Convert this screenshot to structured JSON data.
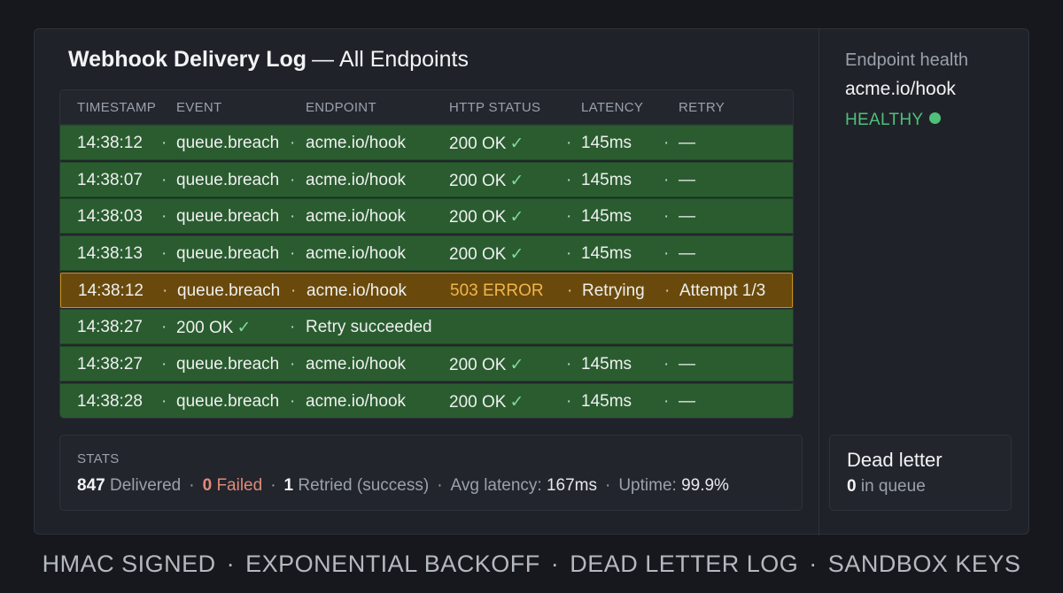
{
  "panel": {
    "title_strong": "Webhook Delivery Log",
    "title_dash": "—",
    "title_rest": "All Endpoints"
  },
  "table": {
    "columns": [
      "TIMESTAMP",
      "EVENT",
      "ENDPOINT",
      "HTTP STATUS",
      "LATENCY",
      "RETRY"
    ],
    "separator": "·",
    "check_glyph": "✓",
    "rows": [
      {
        "timestamp": "14:38:12",
        "event": "queue.breach",
        "endpoint": "acme.io/hook",
        "status": "200 OK",
        "latency": "145ms",
        "retry": "—"
      },
      {
        "timestamp": "14:38:07",
        "event": "queue.breach",
        "endpoint": "acme.io/hook",
        "status": "200 OK",
        "latency": "145ms",
        "retry": "—"
      },
      {
        "timestamp": "14:38:03",
        "event": "queue.breach",
        "endpoint": "acme.io/hook",
        "status": "200 OK",
        "latency": "145ms",
        "retry": "—"
      },
      {
        "timestamp": "14:38:13",
        "event": "queue.breach",
        "endpoint": "acme.io/hook",
        "status": "200 OK",
        "latency": "145ms",
        "retry": "—"
      },
      {
        "timestamp": "14:38:12",
        "event": "queue.breach",
        "endpoint": "acme.io/hook",
        "status": "503 ERROR",
        "latency": "Retrying",
        "retry": "Attempt 1/3"
      },
      {
        "timestamp": "14:38:27",
        "event": "200 OK",
        "endpoint": "Retry succeeded"
      },
      {
        "timestamp": "14:38:27",
        "event": "queue.breach",
        "endpoint": "acme.io/hook",
        "status": "200 OK",
        "latency": "145ms",
        "retry": "—"
      },
      {
        "timestamp": "14:38:28",
        "event": "queue.breach",
        "endpoint": "acme.io/hook",
        "status": "200 OK",
        "latency": "145ms",
        "retry": "—"
      }
    ]
  },
  "stats": {
    "label": "STATS",
    "delivered_count": "847",
    "delivered_label": "Delivered",
    "failed_count": "0",
    "failed_label": "Failed",
    "retried_count": "1",
    "retried_label": "Retried (success)",
    "avg_latency_label": "Avg latency:",
    "avg_latency_value": "167ms",
    "uptime_label": "Uptime:",
    "uptime_value": "99.9%"
  },
  "sidebar": {
    "title": "Endpoint health",
    "endpoint": "acme.io/hook",
    "status": "HEALTHY",
    "status_color": "#4fc07a"
  },
  "dead_letter": {
    "title": "Dead letter",
    "count": "0",
    "label": "in queue"
  },
  "footer": {
    "items": [
      "HMAC SIGNED",
      "EXPONENTIAL BACKOFF",
      "DEAD LETTER LOG",
      "SANDBOX KEYS"
    ],
    "separator": "·"
  },
  "colors": {
    "row_success": "#2a5c30",
    "row_warning": "#6a4a0c",
    "warning_border": "#c8901c",
    "error_text": "#f0b54a",
    "failed_text": "#e08a7a"
  }
}
